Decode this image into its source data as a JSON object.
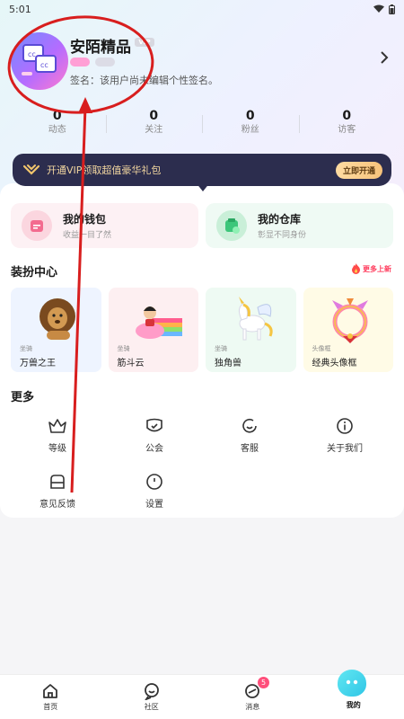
{
  "status_bar": {
    "time": "5:01"
  },
  "profile": {
    "username": "安陌精品",
    "vip_tag": "VIP",
    "signature": "签名：该用户尚未编辑个性签名。"
  },
  "stats": [
    {
      "value": "0",
      "label": "动态"
    },
    {
      "value": "0",
      "label": "关注"
    },
    {
      "value": "0",
      "label": "粉丝"
    },
    {
      "value": "0",
      "label": "访客"
    }
  ],
  "vip_banner": {
    "text": "开通VIP领取超值豪华礼包",
    "button": "立即开通"
  },
  "assets": {
    "wallet": {
      "title": "我的钱包",
      "subtitle": "收益一目了然"
    },
    "warehouse": {
      "title": "我的仓库",
      "subtitle": "彰显不同身份"
    }
  },
  "dress_center": {
    "title": "装扮中心",
    "more_new": "更多上新",
    "items": [
      {
        "type": "坐骑",
        "name": "万兽之王"
      },
      {
        "type": "坐骑",
        "name": "筋斗云"
      },
      {
        "type": "坐骑",
        "name": "独角兽"
      },
      {
        "type": "头像框",
        "name": "经典头像框"
      }
    ]
  },
  "more": {
    "title": "更多",
    "items": [
      {
        "label": "等级",
        "icon": "crown-icon"
      },
      {
        "label": "公会",
        "icon": "guild-icon"
      },
      {
        "label": "客服",
        "icon": "headset-icon"
      },
      {
        "label": "关于我们",
        "icon": "info-icon"
      },
      {
        "label": "意见反馈",
        "icon": "feedback-icon"
      },
      {
        "label": "设置",
        "icon": "settings-icon"
      }
    ]
  },
  "tabbar": [
    {
      "label": "首页",
      "icon": "home-icon"
    },
    {
      "label": "社区",
      "icon": "community-icon"
    },
    {
      "label": "消息",
      "icon": "message-icon",
      "badge": "5"
    },
    {
      "label": "我的",
      "icon": "me-icon",
      "active": true
    }
  ],
  "colors": {
    "vip_banner_bg": "#2c2d4e",
    "vip_gold": "#f2d6a0",
    "annotation_red": "#d81e1e",
    "badge_pink": "#ff4f7b"
  }
}
